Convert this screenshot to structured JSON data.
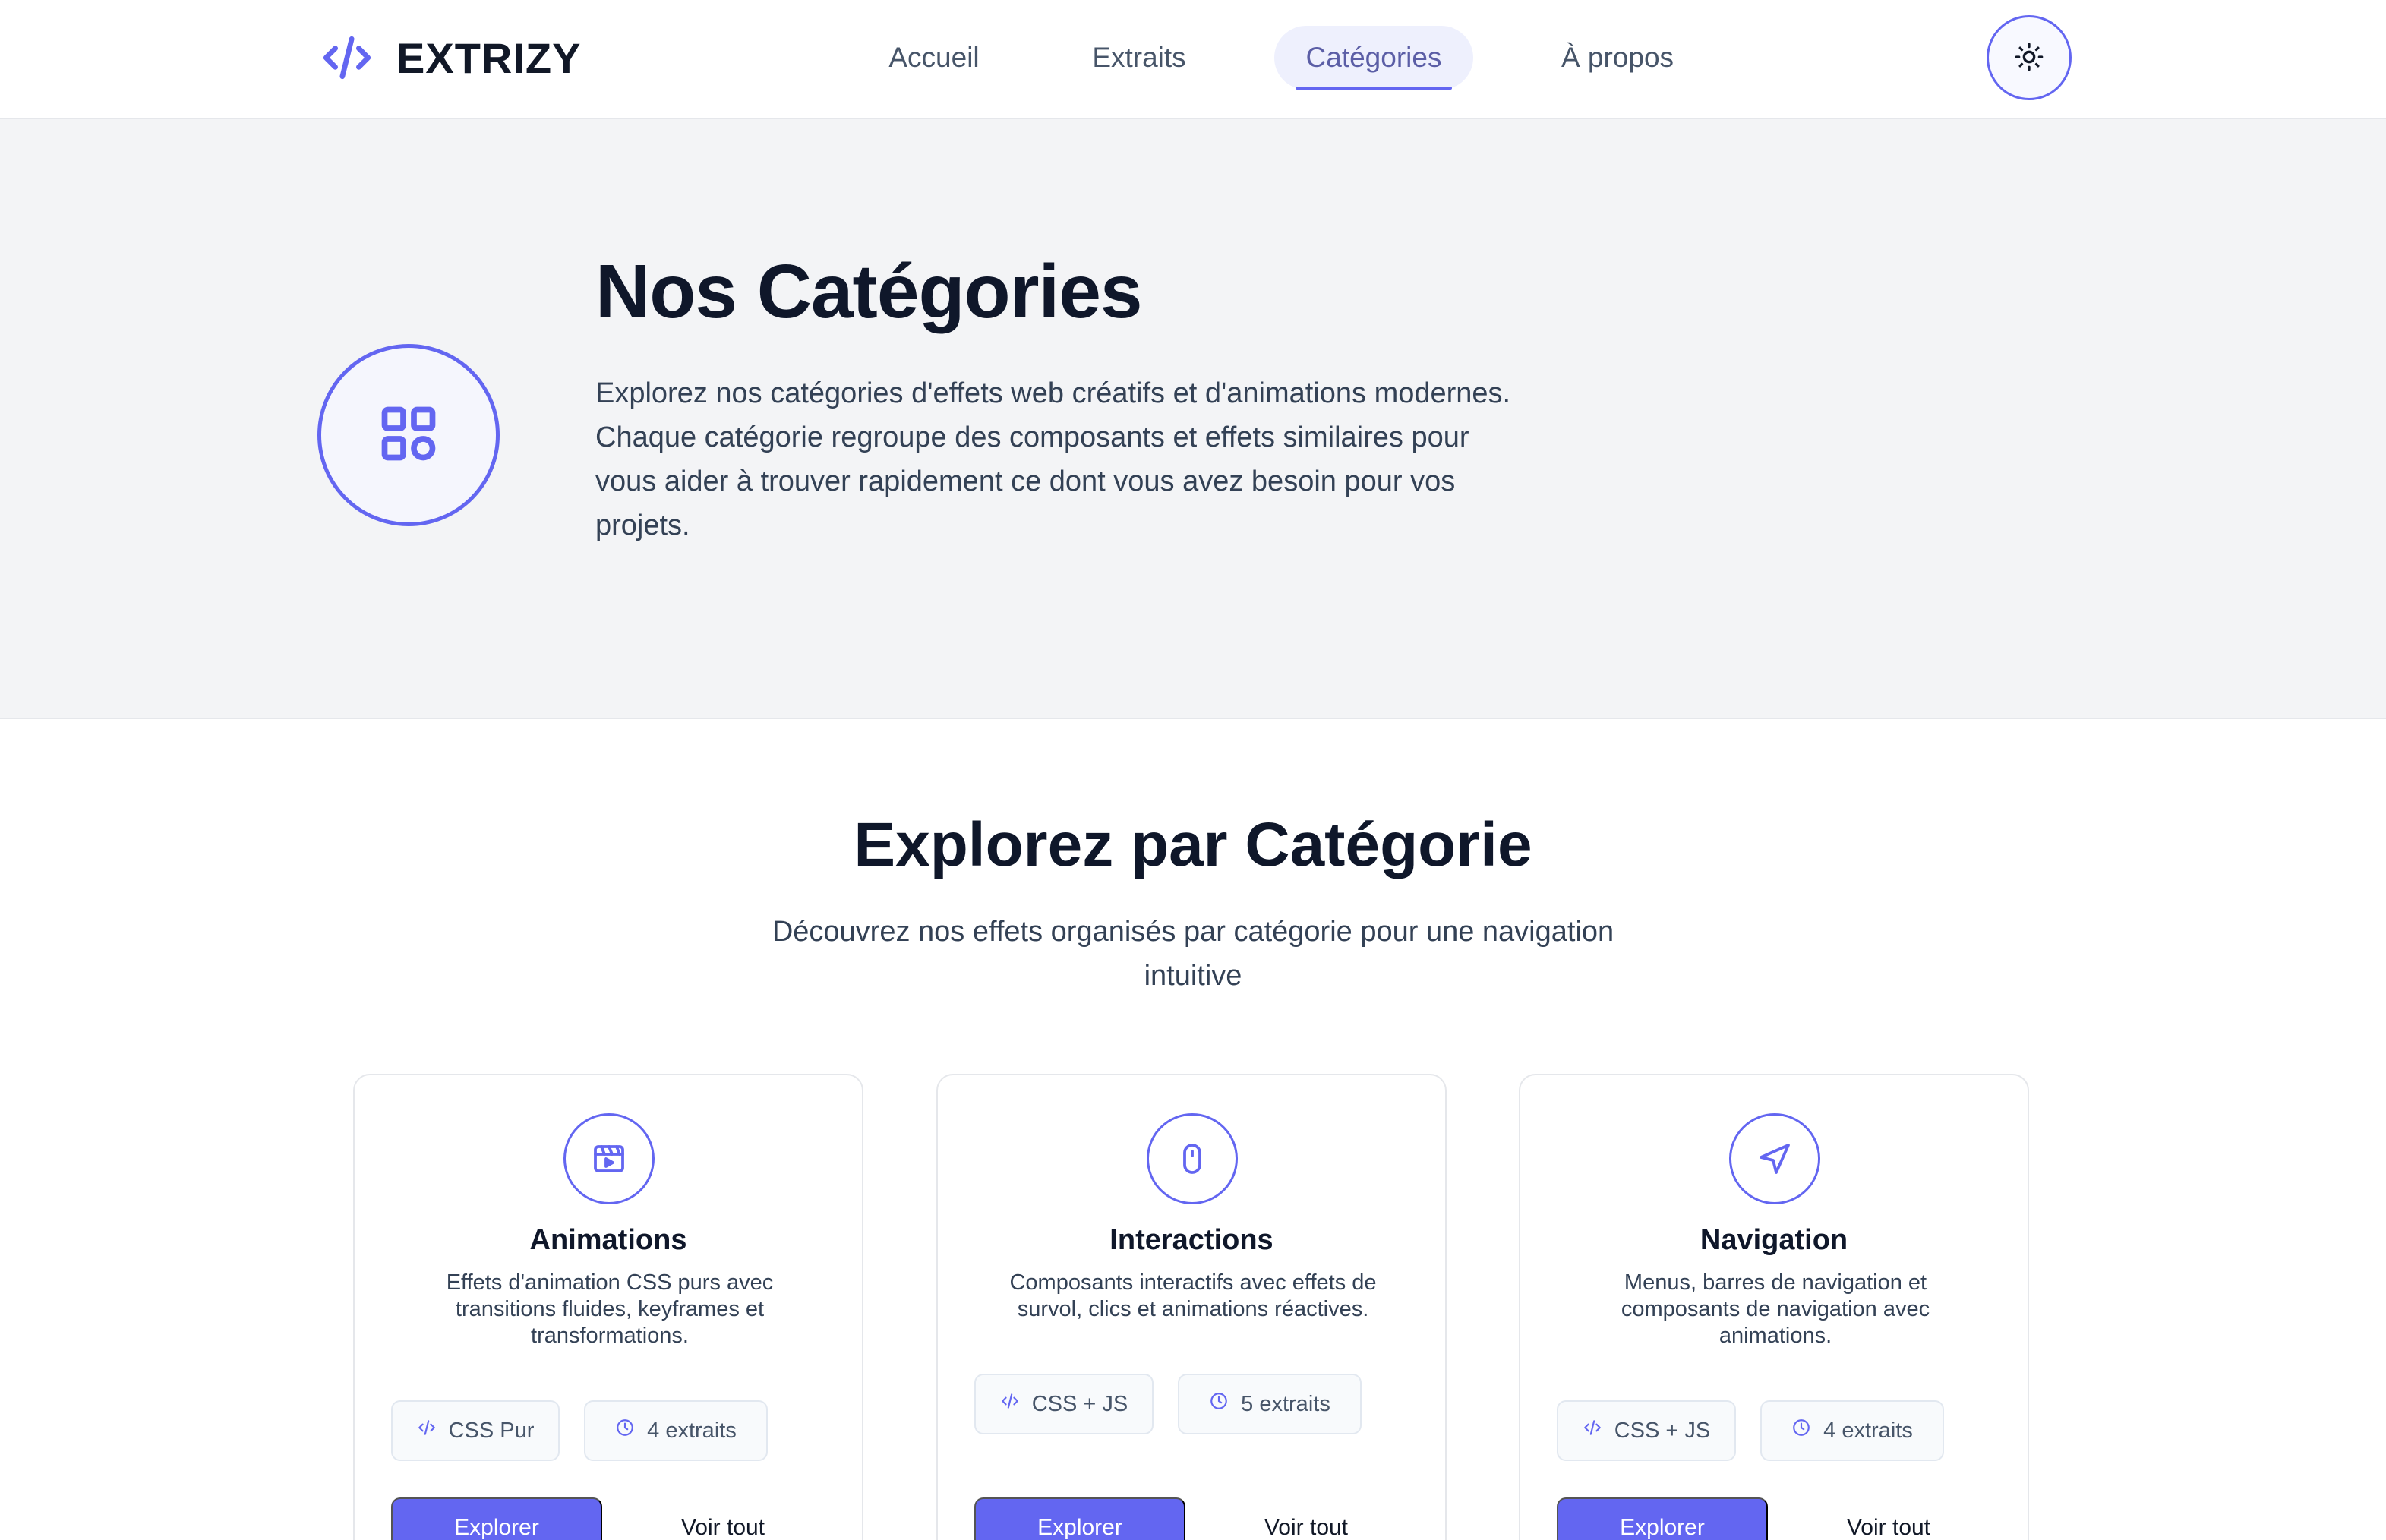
{
  "brand": {
    "name": "EXTRIZY",
    "icon": "code-icon"
  },
  "nav": {
    "links": [
      {
        "label": "Accueil",
        "active": false
      },
      {
        "label": "Extraits",
        "active": false
      },
      {
        "label": "Catégories",
        "active": true
      },
      {
        "label": "À propos",
        "active": false
      }
    ],
    "theme_toggle_icon": "sun-icon"
  },
  "hero": {
    "icon": "grid-icon",
    "title": "Nos Catégories",
    "description": "Explorez nos catégories d'effets web créatifs et d'animations modernes. Chaque catégorie regroupe des composants et effets similaires pour vous aider à trouver rapidement ce dont vous avez besoin pour vos projets."
  },
  "section": {
    "title": "Explorez par Catégorie",
    "subtitle": "Découvrez nos effets organisés par catégorie pour une navigation intuitive"
  },
  "categories": [
    {
      "icon": "clapperboard-icon",
      "title": "Animations",
      "description": "Effets d'animation CSS purs avec transitions fluides, keyframes et transformations.",
      "tech": "CSS Pur",
      "count": "4 extraits",
      "explore_label": "Explorer",
      "view_all_label": "Voir tout"
    },
    {
      "icon": "mouse-icon",
      "title": "Interactions",
      "description": "Composants interactifs avec effets de survol, clics et animations réactives.",
      "tech": "CSS + JS",
      "count": "5 extraits",
      "explore_label": "Explorer",
      "view_all_label": "Voir tout"
    },
    {
      "icon": "navigation-arrow-icon",
      "title": "Navigation",
      "description": "Menus, barres de navigation et composants de navigation avec animations.",
      "tech": "CSS + JS",
      "count": "4 extraits",
      "explore_label": "Explorer",
      "view_all_label": "Voir tout"
    }
  ],
  "colors": {
    "accent": "#6366f1",
    "text_dark": "#0f172a",
    "text_muted": "#334155",
    "hero_bg": "#f3f4f6"
  }
}
